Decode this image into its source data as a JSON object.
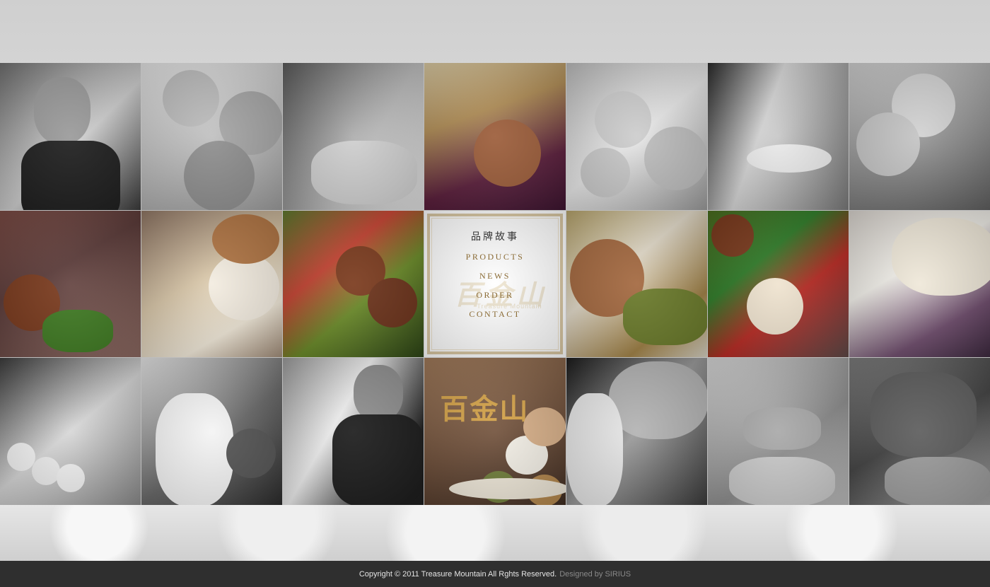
{
  "menu": {
    "items": [
      {
        "label": "品牌故事"
      },
      {
        "label": "PRODUCTS"
      },
      {
        "label": "NEWS"
      },
      {
        "label": "ORDER"
      },
      {
        "label": "CONTACT"
      }
    ],
    "watermark_text": "百金山",
    "watermark_sub": "Treasure Mountain"
  },
  "footer": {
    "copyright": "Copyright © 2011 Treasure Mountain All Rghts Reserved.",
    "designed_by_label": "Designed by",
    "designer": "SIRIUS"
  },
  "tiles": [
    {
      "name": "photo-chef-smiling"
    },
    {
      "name": "photo-meatballs-pile"
    },
    {
      "name": "photo-hands-mixing"
    },
    {
      "name": "photo-meatball-spoon"
    },
    {
      "name": "photo-meatballs-bowl"
    },
    {
      "name": "photo-strainer-kitchen"
    },
    {
      "name": "photo-meatballs-basket"
    },
    {
      "name": "photo-grilled-meatballs-plate"
    },
    {
      "name": "photo-meatball-soup"
    },
    {
      "name": "photo-salad-meatballs"
    },
    {
      "name": "photo-meatball-sauce"
    },
    {
      "name": "photo-peppers-fishball"
    },
    {
      "name": "photo-glass-bowl"
    },
    {
      "name": "photo-strainer-fishballs"
    },
    {
      "name": "photo-cooks-working"
    },
    {
      "name": "photo-chef-cooking"
    },
    {
      "name": "photo-brand-product"
    },
    {
      "name": "photo-cook-focused"
    },
    {
      "name": "photo-hands-shaping"
    },
    {
      "name": "photo-meatball-tray"
    }
  ],
  "brand_product_logo": "百金山"
}
